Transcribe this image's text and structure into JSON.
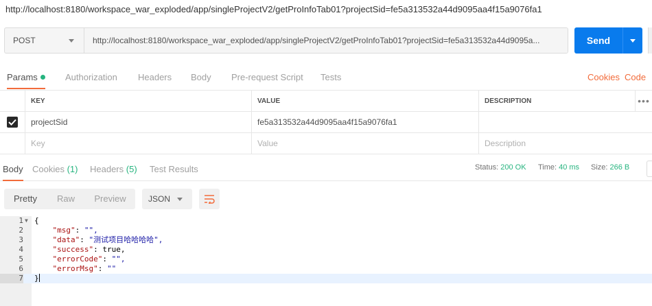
{
  "url_title": "http://localhost:8180/workspace_war_exploded/app/singleProjectV2/getProInfoTab01?projectSid=fe5a313532a44d9095aa4f15a9076fa1",
  "request": {
    "method": "POST",
    "url": "http://localhost:8180/workspace_war_exploded/app/singleProjectV2/getProInfoTab01?projectSid=fe5a313532a44d9095a...",
    "send_label": "Send"
  },
  "request_tabs": {
    "params": "Params",
    "authorization": "Authorization",
    "headers": "Headers",
    "body": "Body",
    "pre_request": "Pre-request Script",
    "tests": "Tests",
    "cookies": "Cookies",
    "code": "Code"
  },
  "params_table": {
    "headers": {
      "key": "KEY",
      "value": "VALUE",
      "description": "DESCRIPTION",
      "more": "•••"
    },
    "rows": [
      {
        "checked": true,
        "key": "projectSid",
        "value": "fe5a313532a44d9095aa4f15a9076fa1",
        "description": ""
      }
    ],
    "placeholders": {
      "key": "Key",
      "value": "Value",
      "description": "Description"
    }
  },
  "response_tabs": {
    "body": "Body",
    "cookies": "Cookies",
    "cookies_count": "(1)",
    "headers": "Headers",
    "headers_count": "(5)",
    "test_results": "Test Results"
  },
  "status": {
    "status_label": "Status:",
    "status_value": "200 OK",
    "time_label": "Time:",
    "time_value": "40 ms",
    "size_label": "Size:",
    "size_value": "266 B"
  },
  "view_toolbar": {
    "pretty": "Pretty",
    "raw": "Raw",
    "preview": "Preview",
    "format": "JSON"
  },
  "code_lines": [
    {
      "n": "1",
      "text": "{"
    },
    {
      "n": "2",
      "key": "\"msg\"",
      "val": "\"\","
    },
    {
      "n": "3",
      "key": "\"data\"",
      "val": "\"测试项目哈哈哈哈\","
    },
    {
      "n": "4",
      "key": "\"success\"",
      "val": "true,"
    },
    {
      "n": "5",
      "key": "\"errorCode\"",
      "val": "\"\","
    },
    {
      "n": "6",
      "key": "\"errorMsg\"",
      "val": "\"\""
    },
    {
      "n": "7",
      "text": "}"
    }
  ],
  "colors": {
    "accent": "#f26b3a",
    "send": "#097bed",
    "success": "#26b47f"
  }
}
